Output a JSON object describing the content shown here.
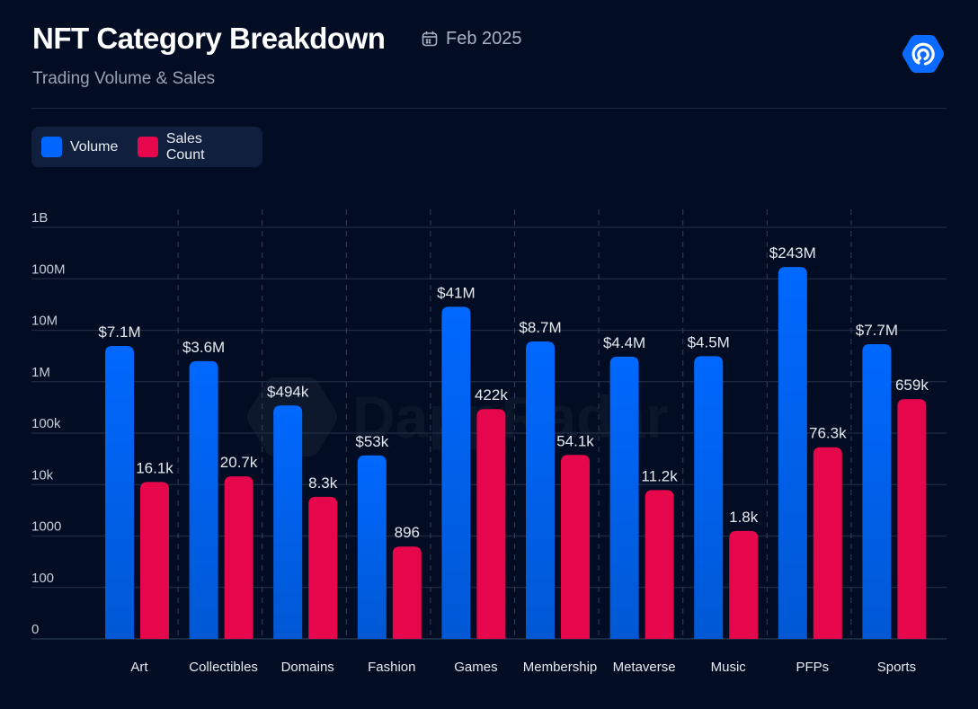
{
  "header": {
    "title": "NFT Category Breakdown",
    "date": "Feb 2025",
    "date_icon": "calendar-icon",
    "subtitle": "Trading Volume & Sales",
    "logo_icon": "dappradar-logo-icon"
  },
  "watermark": "DappRadar",
  "colors": {
    "volume": "#0066ff",
    "volume_bottom": "#0057d6",
    "sales": "#e5064c",
    "background": "#020c22",
    "grid": "#1f2c44"
  },
  "chart_data": {
    "type": "bar",
    "title": "NFT Category Breakdown",
    "subtitle": "Trading Volume & Sales",
    "xlabel": "",
    "ylabel": "",
    "yscale": "log",
    "ylim": [
      10,
      1000000000
    ],
    "yticks": [
      {
        "value": 10,
        "label": "0"
      },
      {
        "value": 100,
        "label": "100"
      },
      {
        "value": 1000,
        "label": "1000"
      },
      {
        "value": 10000,
        "label": "10k"
      },
      {
        "value": 100000,
        "label": "100k"
      },
      {
        "value": 1000000,
        "label": "1M"
      },
      {
        "value": 10000000,
        "label": "10M"
      },
      {
        "value": 100000000,
        "label": "100M"
      },
      {
        "value": 1000000000,
        "label": "1B"
      }
    ],
    "grid": true,
    "legend_position": "top-left",
    "categories": [
      "Art",
      "Collectibles",
      "Domains",
      "Fashion",
      "Games",
      "Membership",
      "Metaverse",
      "Music",
      "PFPs",
      "Sports"
    ],
    "series": [
      {
        "name": "Volume",
        "color": "#0066ff",
        "values": [
          7100000,
          3600000,
          494000,
          53000,
          41000000,
          8700000,
          4400000,
          4500000,
          243000000,
          7700000
        ],
        "labels": [
          "$7.1M",
          "$3.6M",
          "$494k",
          "$53k",
          "$41M",
          "$8.7M",
          "$4.4M",
          "$4.5M",
          "$243M",
          "$7.7M"
        ]
      },
      {
        "name": "Sales Count",
        "color": "#e5064c",
        "values": [
          16100,
          20700,
          8300,
          896,
          422000,
          54100,
          11200,
          1800,
          76300,
          659000
        ],
        "labels": [
          "16.1k",
          "20.7k",
          "8.3k",
          "896",
          "422k",
          "54.1k",
          "11.2k",
          "1.8k",
          "76.3k",
          "659k"
        ]
      }
    ]
  }
}
